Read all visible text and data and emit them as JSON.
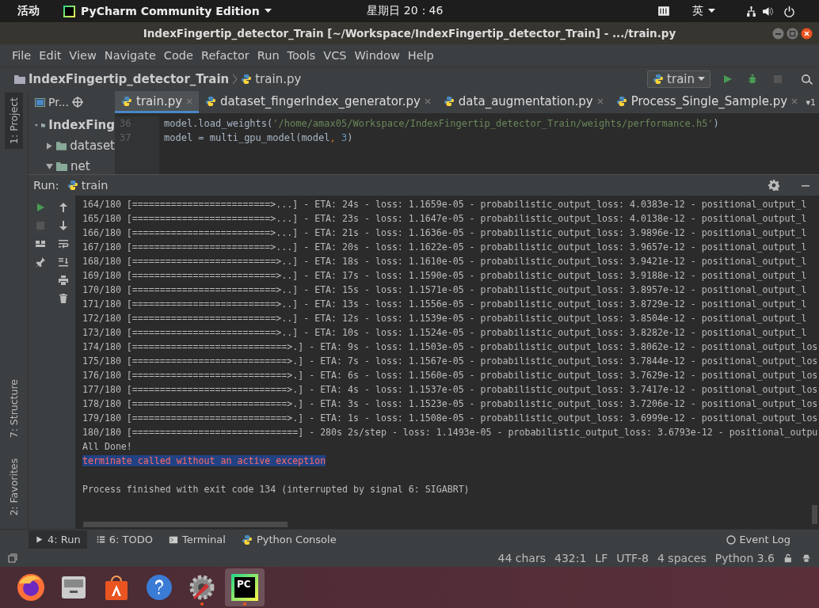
{
  "top_bar": {
    "activities": "活动",
    "app": "PyCharm Community Edition",
    "clock": "星期日 20：46",
    "input_method": "英"
  },
  "window": {
    "title": "IndexFingertip_detector_Train [~/Workspace/IndexFingertip_detector_Train] - .../train.py"
  },
  "menu": [
    "File",
    "Edit",
    "View",
    "Navigate",
    "Code",
    "Refactor",
    "Run",
    "Tools",
    "VCS",
    "Window",
    "Help"
  ],
  "breadcrumb": {
    "project": "IndexFingertip_detector_Train",
    "file": "train.py"
  },
  "run_config": "train",
  "project_panel": {
    "title": "Pr...",
    "items": [
      {
        "label": "IndexFing",
        "expanded": true,
        "children": [
          {
            "label": "dataset",
            "expanded": false
          },
          {
            "label": "net",
            "expanded": true
          }
        ]
      }
    ]
  },
  "tabs": [
    {
      "label": "train.py",
      "selected": true
    },
    {
      "label": "dataset_fingerIndex_generator.py",
      "selected": false
    },
    {
      "label": "data_augmentation.py",
      "selected": false
    },
    {
      "label": "Process_Single_Sample.py",
      "selected": false
    }
  ],
  "tabs_overflow": "▾1",
  "editor": {
    "lines": [
      {
        "number": "36",
        "tokens": [
          {
            "kind": "plain",
            "text": "model.load_weights("
          },
          {
            "kind": "string",
            "text": "'/home/amax05/Workspace/IndexFingertip_detector_Train/weights/performance.h5'"
          },
          {
            "kind": "plain",
            "text": ")"
          }
        ]
      },
      {
        "number": "37",
        "tokens": [
          {
            "kind": "plain",
            "text": "model = multi_gpu_model(model"
          },
          {
            "kind": "punct",
            "text": ", "
          },
          {
            "kind": "number",
            "text": "3"
          },
          {
            "kind": "plain",
            "text": ")"
          }
        ]
      }
    ]
  },
  "side_tabs_top": [
    {
      "label": "1: Project",
      "selected": true
    }
  ],
  "side_tabs_bottom": [
    {
      "label": "7: Structure",
      "selected": false
    },
    {
      "label": "2: Favorites",
      "selected": false
    }
  ],
  "run_panel": {
    "label": "Run:",
    "tab": "train"
  },
  "console": [
    {
      "kind": "progress",
      "text": "164/180 [=========================>...] - ETA: 24s - loss: 1.1659e-05 - probabilistic_output_loss: 4.0383e-12 - positional_output_l"
    },
    {
      "kind": "progress",
      "text": "165/180 [=========================>...] - ETA: 23s - loss: 1.1647e-05 - probabilistic_output_loss: 4.0138e-12 - positional_output_l"
    },
    {
      "kind": "progress",
      "text": "166/180 [=========================>...] - ETA: 21s - loss: 1.1636e-05 - probabilistic_output_loss: 3.9896e-12 - positional_output_l"
    },
    {
      "kind": "progress",
      "text": "167/180 [=========================>...] - ETA: 20s - loss: 1.1622e-05 - probabilistic_output_loss: 3.9657e-12 - positional_output_l"
    },
    {
      "kind": "progress",
      "text": "168/180 [==========================>..] - ETA: 18s - loss: 1.1610e-05 - probabilistic_output_loss: 3.9421e-12 - positional_output_l"
    },
    {
      "kind": "progress",
      "text": "169/180 [==========================>..] - ETA: 17s - loss: 1.1590e-05 - probabilistic_output_loss: 3.9188e-12 - positional_output_l"
    },
    {
      "kind": "progress",
      "text": "170/180 [==========================>..] - ETA: 15s - loss: 1.1571e-05 - probabilistic_output_loss: 3.8957e-12 - positional_output_l"
    },
    {
      "kind": "progress",
      "text": "171/180 [==========================>..] - ETA: 13s - loss: 1.1556e-05 - probabilistic_output_loss: 3.8729e-12 - positional_output_l"
    },
    {
      "kind": "progress",
      "text": "172/180 [==========================>..] - ETA: 12s - loss: 1.1539e-05 - probabilistic_output_loss: 3.8504e-12 - positional_output_l"
    },
    {
      "kind": "progress",
      "text": "173/180 [==========================>..] - ETA: 10s - loss: 1.1524e-05 - probabilistic_output_loss: 3.8282e-12 - positional_output_l"
    },
    {
      "kind": "progress",
      "text": "174/180 [============================>.] - ETA: 9s - loss: 1.1503e-05 - probabilistic_output_loss: 3.8062e-12 - positional_output_los"
    },
    {
      "kind": "progress",
      "text": "175/180 [============================>.] - ETA: 7s - loss: 1.1567e-05 - probabilistic_output_loss: 3.7844e-12 - positional_output_los"
    },
    {
      "kind": "progress",
      "text": "176/180 [============================>.] - ETA: 6s - loss: 1.1560e-05 - probabilistic_output_loss: 3.7629e-12 - positional_output_los"
    },
    {
      "kind": "progress",
      "text": "177/180 [============================>.] - ETA: 4s - loss: 1.1537e-05 - probabilistic_output_loss: 3.7417e-12 - positional_output_los"
    },
    {
      "kind": "progress",
      "text": "178/180 [============================>.] - ETA: 3s - loss: 1.1523e-05 - probabilistic_output_loss: 3.7206e-12 - positional_output_los"
    },
    {
      "kind": "progress",
      "text": "179/180 [============================>.] - ETA: 1s - loss: 1.1508e-05 - probabilistic_output_loss: 3.6999e-12 - positional_output_los"
    },
    {
      "kind": "progress",
      "text": "180/180 [==============================] - 280s 2s/step - loss: 1.1493e-05 - probabilistic_output_loss: 3.6793e-12 - positional_outpu"
    },
    {
      "kind": "plain",
      "text": "All Done!"
    },
    {
      "kind": "error",
      "text": "terminate called without an active exception"
    },
    {
      "kind": "blank"
    },
    {
      "kind": "plain",
      "text": "Process finished with exit code 134 (interrupted by signal 6: SIGABRT)"
    }
  ],
  "bottom_tabs": [
    {
      "label": "4: Run",
      "kind": "run",
      "selected": true
    },
    {
      "label": "6: TODO",
      "kind": "todo",
      "selected": false
    },
    {
      "label": "Terminal",
      "kind": "terminal",
      "selected": false
    },
    {
      "label": "Python Console",
      "kind": "console",
      "selected": false
    }
  ],
  "event_log": "Event Log",
  "status_bar": [
    "44 chars",
    "432:1",
    "LF",
    "UTF-8",
    "4 spaces",
    "Python 3.6"
  ],
  "dock": [
    {
      "kind": "firefox",
      "running": false
    },
    {
      "kind": "files",
      "running": false
    },
    {
      "kind": "store",
      "running": false
    },
    {
      "kind": "help",
      "running": false
    },
    {
      "kind": "settings",
      "running": true
    },
    {
      "kind": "pycharm",
      "running": true,
      "selected": true,
      "label": "PC"
    }
  ]
}
